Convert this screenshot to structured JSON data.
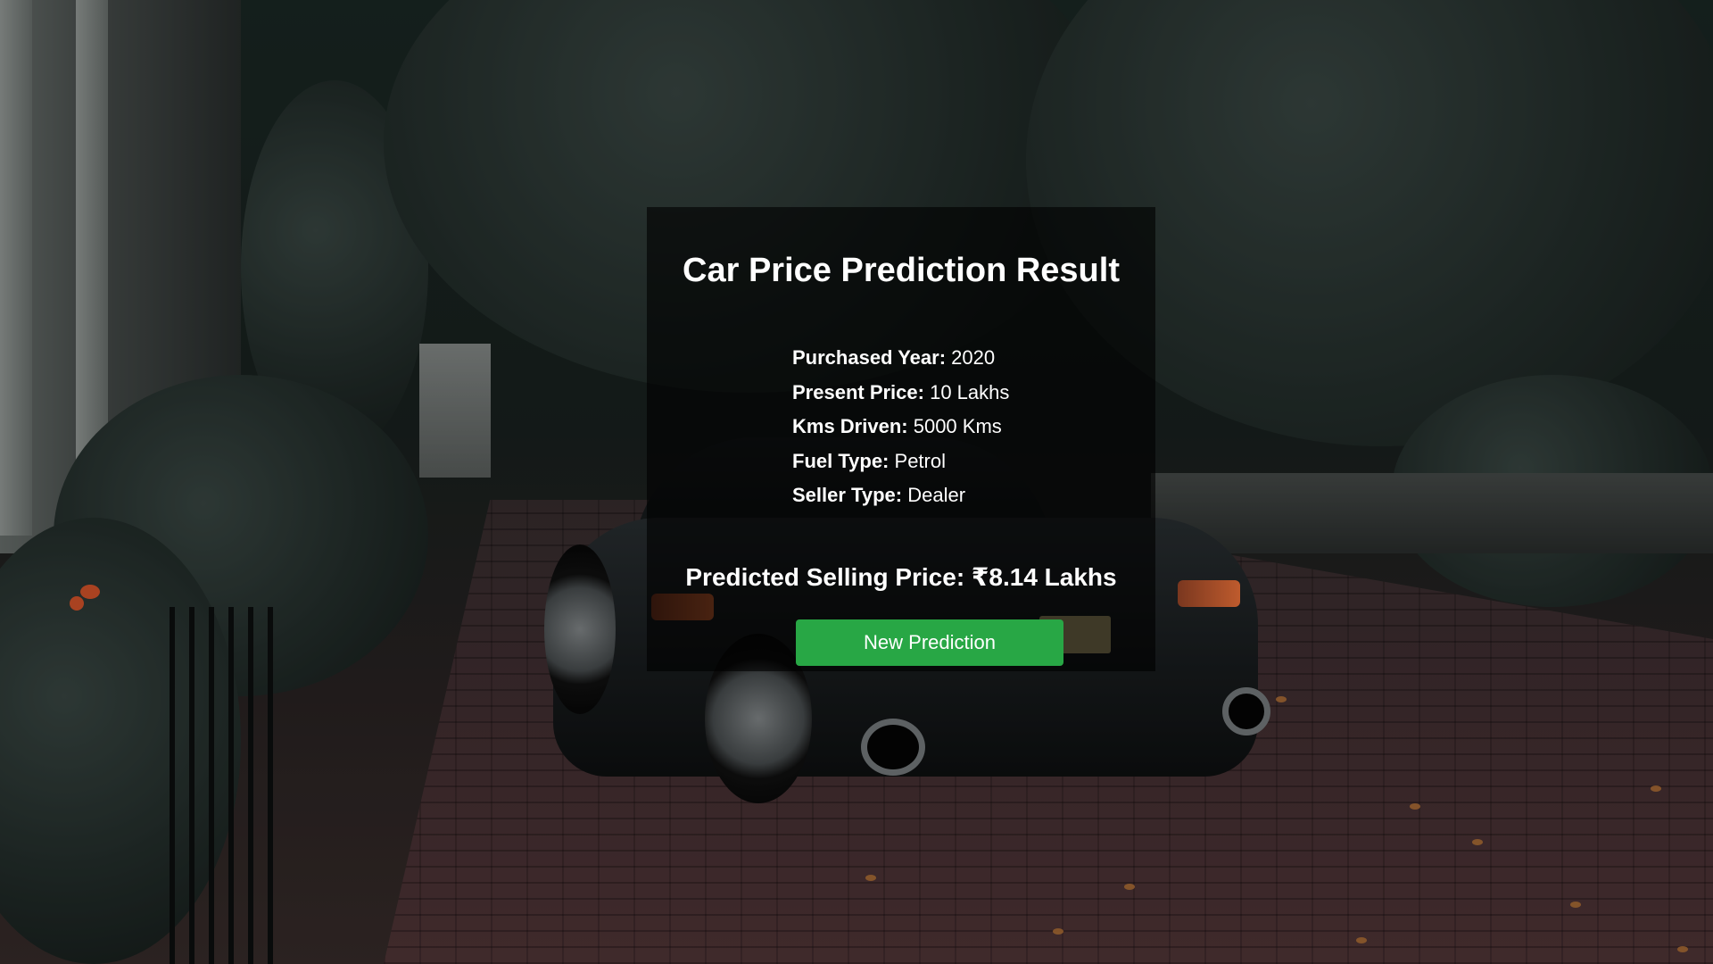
{
  "page": {
    "title": "Car Price Prediction Result"
  },
  "details": [
    {
      "label": "Purchased Year:",
      "value": "2020"
    },
    {
      "label": "Present Price:",
      "value": "10 Lakhs"
    },
    {
      "label": "Kms Driven:",
      "value": "5000 Kms"
    },
    {
      "label": "Fuel Type:",
      "value": "Petrol"
    },
    {
      "label": "Seller Type:",
      "value": "Dealer"
    }
  ],
  "result": {
    "predicted_text": "Predicted Selling Price: ₹8.14 Lakhs"
  },
  "actions": {
    "new_prediction_label": "New Prediction"
  },
  "colors": {
    "button": "#28a745",
    "card_overlay": "rgba(0,0,0,0.62)",
    "text": "#ffffff"
  }
}
